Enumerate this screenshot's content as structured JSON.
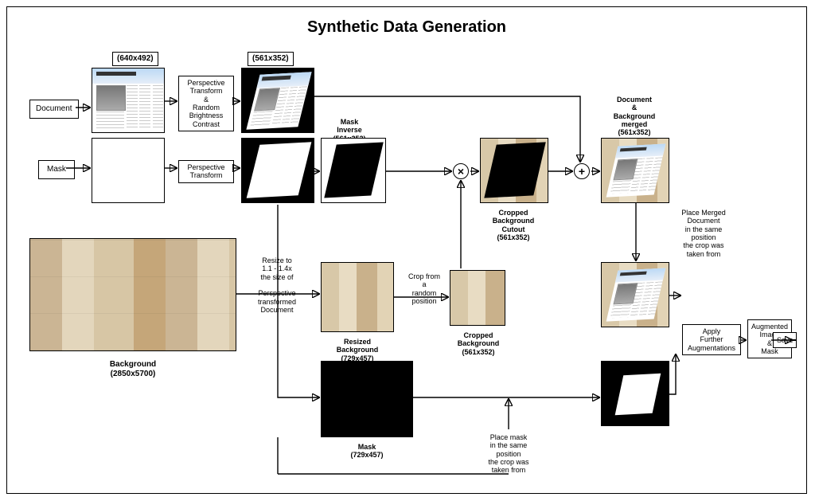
{
  "title": "Synthetic Data Generation",
  "dims": {
    "doc_in": "(640x492)",
    "doc_pt": "(561x352)"
  },
  "row_labels": {
    "document": "Document",
    "mask": "Mask"
  },
  "ops": {
    "persp_bright": "Perspective\nTransform\n&\nRandom\nBrightness\nContrast",
    "persp": "Perspective\nTransform"
  },
  "labels": {
    "mask_inverse": "Mask\nInverse\n(561x352)",
    "cropped_bg_cutout": "Cropped\nBackground\nCutout\n(561x352)",
    "doc_bg_merged": "Document\n&\nBackground\nmerged\n(561x352)",
    "place_merged": "Place Merged\nDocument\nin the same\nposition\nthe crop was\ntaken from",
    "resize_note": "Resize to\n1.1 - 1.4x\nthe size of\n\nPerspective\ntransformed\nDocument",
    "crop_note": "Crop from\na\nrandom\nposition",
    "resized_bg": "Resized\nBackground\n(729x457)",
    "cropped_bg": "Cropped\nBackground\n(561x352)",
    "bg_caption": "Background\n(2850x5700)",
    "mask_729": "Mask\n(729x457)",
    "place_mask": "Place mask\nin the same\nposition\nthe crop was\ntaken from",
    "apply_aug": "Apply\nFurther\nAugmentations",
    "aug_out": "Augmented\nImage\n&\nMask",
    "save": "Save"
  }
}
